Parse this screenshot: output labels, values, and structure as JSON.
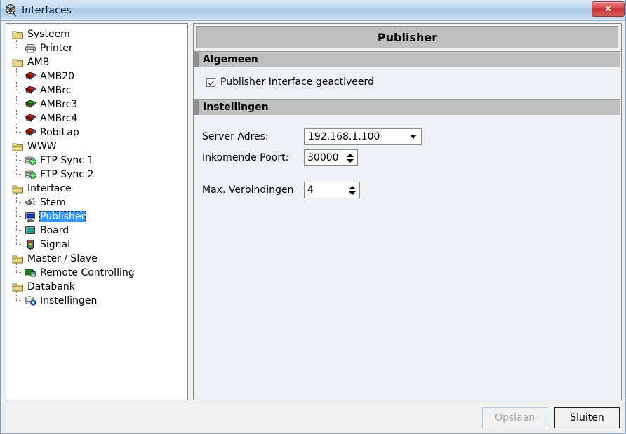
{
  "window": {
    "title": "Interfaces",
    "icon": "network-globe-icon",
    "close_label": "✕"
  },
  "tree": {
    "items": [
      {
        "label": "Systeem",
        "level": 0,
        "icon": "folder-icon",
        "selected": false
      },
      {
        "label": "Printer",
        "level": 1,
        "icon": "printer-icon",
        "selected": false
      },
      {
        "label": "AMB",
        "level": 0,
        "icon": "folder-icon",
        "selected": false
      },
      {
        "label": "AMB20",
        "level": 1,
        "icon": "chip-red-icon",
        "selected": false
      },
      {
        "label": "AMBrc",
        "level": 1,
        "icon": "chip-red-icon",
        "selected": false
      },
      {
        "label": "AMBrc3",
        "level": 1,
        "icon": "chip-green-icon",
        "selected": false
      },
      {
        "label": "AMBrc4",
        "level": 1,
        "icon": "chip-red-icon",
        "selected": false
      },
      {
        "label": "RobiLap",
        "level": 1,
        "icon": "chip-red-icon",
        "selected": false
      },
      {
        "label": "WWW",
        "level": 0,
        "icon": "folder-icon",
        "selected": false
      },
      {
        "label": "FTP Sync 1",
        "level": 1,
        "icon": "server-globe-icon",
        "selected": false
      },
      {
        "label": "FTP Sync 2",
        "level": 1,
        "icon": "server-globe-icon",
        "selected": false
      },
      {
        "label": "Interface",
        "level": 0,
        "icon": "folder-icon",
        "selected": false
      },
      {
        "label": "Stem",
        "level": 1,
        "icon": "megaphone-icon",
        "selected": false
      },
      {
        "label": "Publisher",
        "level": 1,
        "icon": "monitor-blue-icon",
        "selected": true
      },
      {
        "label": "Board",
        "level": 1,
        "icon": "monitor-teal-icon",
        "selected": false
      },
      {
        "label": "Signal",
        "level": 1,
        "icon": "traffic-light-icon",
        "selected": false
      },
      {
        "label": "Master / Slave",
        "level": 0,
        "icon": "folder-icon",
        "selected": false
      },
      {
        "label": "Remote Controlling",
        "level": 1,
        "icon": "remote-green-icon",
        "selected": false
      },
      {
        "label": "Databank",
        "level": 0,
        "icon": "folder-icon",
        "selected": false
      },
      {
        "label": "Instellingen",
        "level": 1,
        "icon": "database-gear-icon",
        "selected": false
      }
    ]
  },
  "panel": {
    "title": "Publisher",
    "section_general": {
      "header": "Algemeen",
      "checkbox_label": "Publisher Interface geactiveerd",
      "checkbox_checked": true
    },
    "section_settings": {
      "header": "Instellingen",
      "server_address": {
        "label": "Server Adres:",
        "value": "192.168.1.100",
        "options": [
          "192.168.1.100"
        ]
      },
      "incoming_port": {
        "label": "Inkomende Poort:",
        "value": "30000"
      },
      "max_connections": {
        "label": "Max. Verbindingen",
        "value": "4"
      }
    }
  },
  "footer": {
    "save_label": "Opslaan",
    "save_enabled": false,
    "close_label": "Sluiten",
    "close_enabled": true
  },
  "colors": {
    "selection_blue": "#3399ff",
    "section_gray": "#c0c0c0",
    "panel_bg": "#eff0f3",
    "titlebar_blue": "#bcd5ec",
    "close_red": "#d94b4b"
  }
}
